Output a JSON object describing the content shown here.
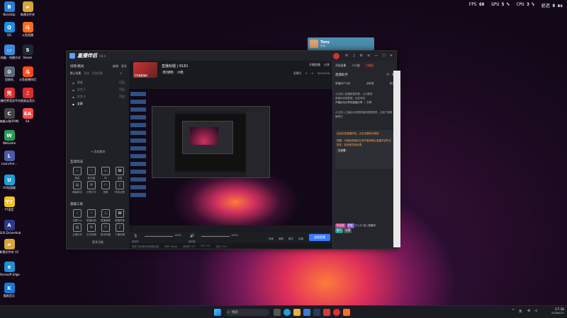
{
  "overlay": {
    "fps_label": "FPS",
    "fps": "60",
    "gpu_label": "GPU",
    "gpu": "5 %",
    "cpu_label": "CPU",
    "cpu": "3 %",
    "latency_label": "延迟",
    "latency": "0 ms"
  },
  "desktop_icons": [
    {
      "label": "Bandizip",
      "color": "#2a7fd6",
      "glyph": "B"
    },
    {
      "label": "新建文件夹",
      "color": "#d9a534",
      "glyph": "▰"
    },
    {
      "label": "QQ",
      "color": "#1d8fe0",
      "glyph": "Q"
    },
    {
      "label": "斗鱼直播",
      "color": "#ff6b1a",
      "glyph": "斗"
    },
    {
      "label": "此电脑 - 快捷方式",
      "color": "#3a8ad6",
      "glyph": "▭"
    },
    {
      "label": "Steam",
      "color": "#1b2838",
      "glyph": "S"
    },
    {
      "label": "回收站",
      "color": "#5a6a7a",
      "glyph": "♻"
    },
    {
      "label": "斗鱼直播伴侣",
      "color": "#ff4a1a",
      "glyph": "斗"
    },
    {
      "label": "完美世界竞技平台",
      "color": "#d83030",
      "glyph": "完"
    },
    {
      "label": "网易云音乐",
      "color": "#e02b2b",
      "glyph": "♫"
    },
    {
      "label": "穿越火线(FAM)",
      "color": "#444",
      "glyph": "C"
    },
    {
      "label": "EA",
      "color": "#ff4a4a",
      "glyph": "EA"
    },
    {
      "label": "WeGame",
      "color": "#2a9a5a",
      "glyph": "W"
    },
    {
      "label": "Launcher...",
      "color": "#4a5aa8",
      "glyph": "L"
    },
    {
      "label": "UU加速器",
      "color": "#1aa0d8",
      "glyph": "U"
    },
    {
      "label": "YY语音",
      "color": "#f3c41a",
      "glyph": "YY"
    },
    {
      "label": "ASUS DriverHub",
      "color": "#2a3a8a",
      "glyph": "A"
    },
    {
      "label": "新建文件夹 (2)",
      "color": "#d9a534",
      "glyph": "▰"
    },
    {
      "label": "Microsoft Edge",
      "color": "#1f8fd6",
      "glyph": "e"
    },
    {
      "label": "酷狗音乐",
      "color": "#1a78e0",
      "glyph": "K"
    }
  ],
  "tooltip": {
    "name": "Tony",
    "sub": "在线"
  },
  "window": {
    "app_name": "直播伴侣",
    "version": "V8.0",
    "live_title": "直播标题 | 8181",
    "cover_label": "已开播直播间",
    "tag1": "热门游戏",
    "tag2": "人物",
    "btn_open_stream": "开播直播",
    "btn_share": "分享",
    "stat1": "直播间",
    "stat2": "0",
    "stat3": "0",
    "stat4": "00:00:00",
    "scene_title": "场景/模式",
    "scene_edit": "编辑",
    "scene_more": "更多",
    "scene_tabs": [
      "默认场景",
      "添加",
      "添加场景"
    ],
    "scene_items": [
      {
        "name": "摄像",
        "status": "可见"
      },
      {
        "name": "文字 1",
        "status": "可见"
      },
      {
        "name": "文字 2",
        "status": "可见"
      },
      {
        "name": "全屏",
        "status": ""
      }
    ],
    "add_source": "+ 添加素材",
    "interact_title": "互动玩法",
    "interact_tiles": [
      "抽奖",
      "粉丝团",
      "PK",
      "连麦",
      "弹幕助手",
      "分享口令",
      "房管",
      "特效点歌"
    ],
    "tools_title": "基础工具",
    "tool_tiles": [
      "设置Fps",
      "直播回放",
      "直播截图",
      "直播背景",
      "主播任务",
      "生成海报",
      "推流设置",
      "下播设置"
    ],
    "more_tools": "更多功能",
    "vol_label_1": "麦克风",
    "vol_1": "100%",
    "vol_label_2": "扬声器",
    "vol_2": "100%",
    "btn_effects": "特效",
    "btn_beauty": "美颜",
    "btn_mode": "模式",
    "btn_settings": "设置",
    "btn_start": "连接直播",
    "status_bar": [
      "仅用于检测防伪和参数设置",
      "码率: 0kbps",
      "丢帧率: 0%",
      "CPU: 3%",
      "内存: 32%"
    ],
    "right_tabs": [
      "开始直播",
      "人口流",
      "大数据"
    ],
    "assistant_title": "直播助手",
    "assistant_tabs": [
      "直播用户分析",
      "活跃度",
      "粉丝"
    ],
    "assistant_text1": "点击进入直播数据查看，主动推荐",
    "assistant_text2": "直播间详细数据，欢迎体验",
    "assistant_text3": "开播自动分享到直播分享 ｜ 分享",
    "assistant_text4": "点击进入主播后台查看直播间数据报表，全面了解直播情况",
    "notice_title": "欢迎来到直播伴侣，点击查看新手教程",
    "notice_text": "提醒：为确保直播间正常开播请确认直播内容符合规范，若违规将被处理。",
    "notice_link": "去查看",
    "chat_badge1": "粉丝团",
    "chat_badge2": "贵族",
    "chat_user": "开心玩",
    "chat_msg": "进入直播间",
    "chat_badge3": "新人",
    "chat_badge4": "礼物"
  },
  "taskbar": {
    "search": "搜索",
    "time": "17:38",
    "date": "2026/4/21",
    "lang": "英"
  },
  "colors": {
    "accent": "#ff5a3a",
    "start_btn": "#3a7bff",
    "panel": "#1d1e24"
  }
}
